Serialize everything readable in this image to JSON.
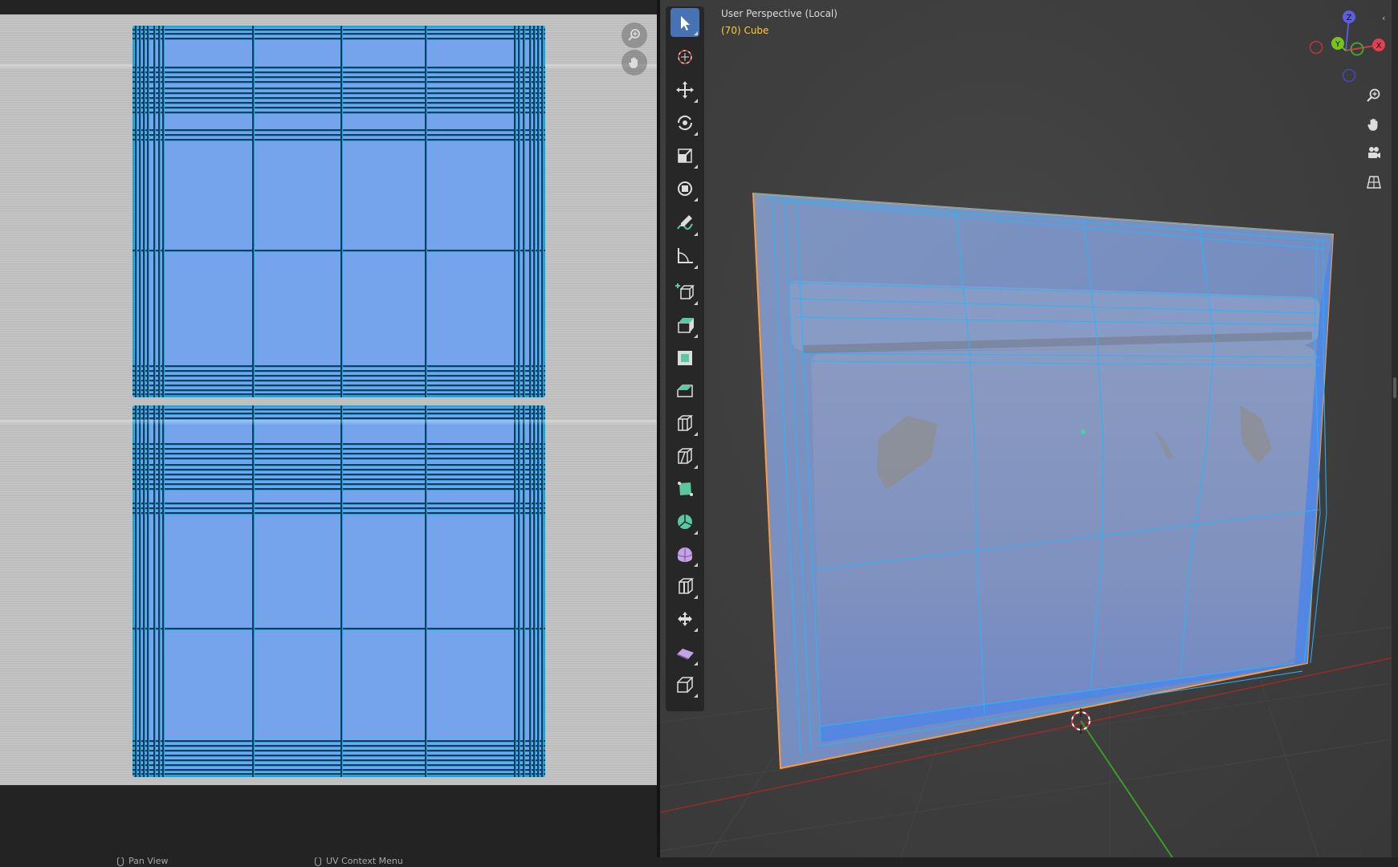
{
  "uv_editor": {
    "nav": {
      "zoom_icon": "zoom-magnifier-icon",
      "pan_icon": "hand-pan-icon"
    }
  },
  "viewport": {
    "title": "User Perspective (Local)",
    "object_info": "(70) Cube",
    "gizmo_axes": [
      "X",
      "Y",
      "Z"
    ],
    "axis_colors": {
      "x": "#ff3352",
      "y": "#8bdc00",
      "z": "#2890ff"
    },
    "nav_buttons": [
      "zoom-icon",
      "hand-pan-icon",
      "camera-icon",
      "perspective-grid-icon"
    ],
    "tools": [
      "select-box",
      "cursor",
      "move",
      "rotate",
      "scale",
      "transform",
      "annotate",
      "measure",
      "add-cube",
      "extrude-region",
      "inset-faces",
      "bevel",
      "loop-cut",
      "knife",
      "poly-build",
      "spin",
      "smooth",
      "edge-slide",
      "shrink-fatten",
      "shear",
      "rip-region"
    ]
  },
  "status_bar": {
    "left_item": "Pan View",
    "right_item": "UV Context Menu"
  },
  "colors": {
    "uv_face": "#76a4ec",
    "uv_edge": "#17a7e0",
    "selection_outline": "#ff9a3c",
    "active_tool": "#4772b3"
  }
}
